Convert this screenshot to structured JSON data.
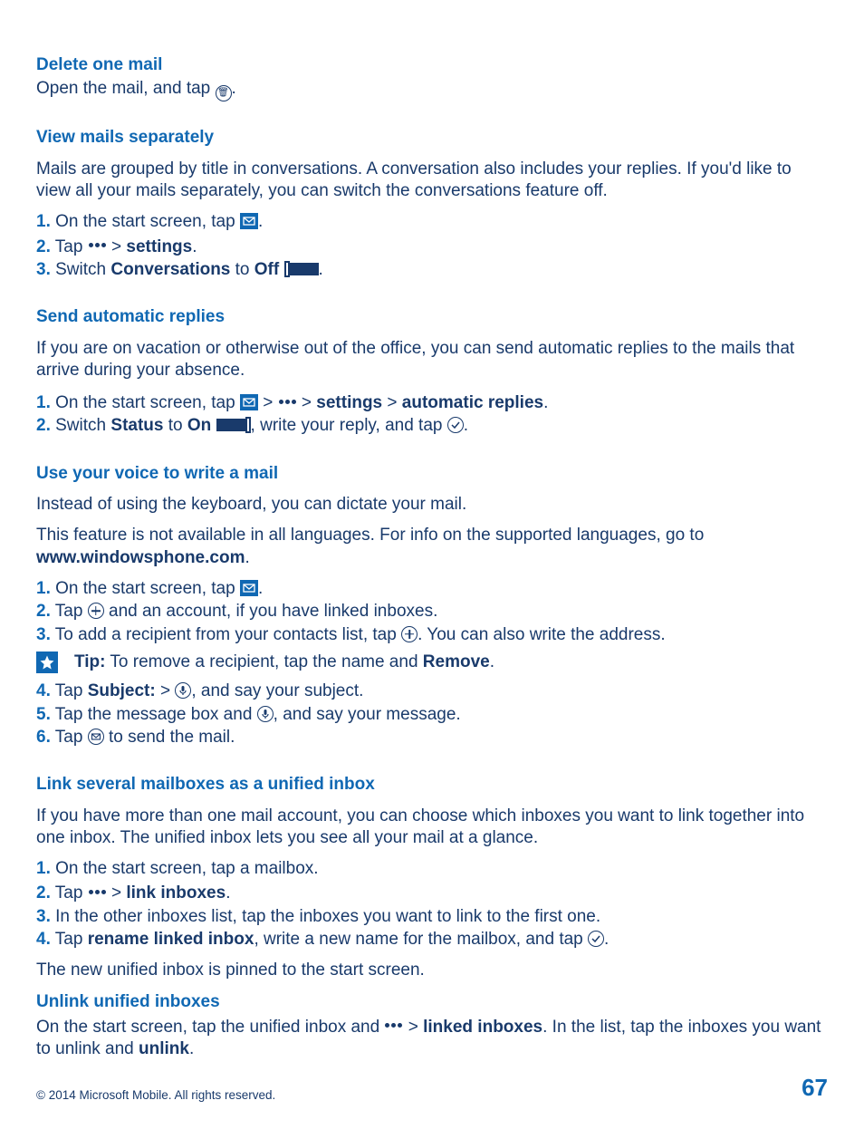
{
  "sec1": {
    "title": "Delete one mail",
    "line1a": "Open the mail, and tap ",
    "line1b": "."
  },
  "sec2": {
    "title": "View mails separately",
    "para": "Mails are grouped by title in conversations. A conversation also includes your replies. If you'd like to view all your mails separately, you can switch the conversations feature off.",
    "n1": "1.",
    "s1a": " On the start screen, tap ",
    "s1b": ".",
    "n2": "2.",
    "s2a": " Tap ",
    "s2b": " > ",
    "s2c": "settings",
    "s2d": ".",
    "n3": "3.",
    "s3a": " Switch ",
    "s3b": "Conversations",
    "s3c": " to ",
    "s3d": "Off",
    "s3e": " ",
    "s3f": "."
  },
  "sec3": {
    "title": "Send automatic replies",
    "para": "If you are on vacation or otherwise out of the office, you can send automatic replies to the mails that arrive during your absence.",
    "n1": "1.",
    "s1a": " On the start screen, tap ",
    "s1b": " > ",
    "s1c": " > ",
    "s1d": "settings",
    "s1e": " > ",
    "s1f": "automatic replies",
    "s1g": ".",
    "n2": "2.",
    "s2a": " Switch ",
    "s2b": "Status",
    "s2c": " to ",
    "s2d": "On",
    "s2e": " ",
    "s2f": ", write your reply, and tap ",
    "s2g": "."
  },
  "sec4": {
    "title": "Use your voice to write a mail",
    "para1": "Instead of using the keyboard, you can dictate your mail.",
    "para2a": "This feature is not available in all languages. For info on the supported languages, go to ",
    "para2b": "www.windowsphone.com",
    "para2c": ".",
    "n1": "1.",
    "s1a": " On the start screen, tap ",
    "s1b": ".",
    "n2": "2.",
    "s2a": " Tap ",
    "s2b": " and an account, if you have linked inboxes.",
    "n3": "3.",
    "s3a": " To add a recipient from your contacts list, tap ",
    "s3b": ". You can also write the address.",
    "tipLabel": "Tip:",
    "tipText": " To remove a recipient, tap the name and ",
    "tipBold": "Remove",
    "tipEnd": ".",
    "n4": "4.",
    "s4a": " Tap ",
    "s4b": "Subject:",
    "s4c": " > ",
    "s4d": ", and say your subject.",
    "n5": "5.",
    "s5a": " Tap the message box and ",
    "s5b": ", and say your message.",
    "n6": "6.",
    "s6a": " Tap ",
    "s6b": " to send the mail."
  },
  "sec5": {
    "title": "Link several mailboxes as a unified inbox",
    "para": "If you have more than one mail account, you can choose which inboxes you want to link together into one inbox. The unified inbox lets you see all your mail at a glance.",
    "n1": "1.",
    "s1": " On the start screen, tap a mailbox.",
    "n2": "2.",
    "s2a": " Tap ",
    "s2b": " > ",
    "s2c": "link inboxes",
    "s2d": ".",
    "n3": "3.",
    "s3": " In the other inboxes list, tap the inboxes you want to link to the first one.",
    "n4": "4.",
    "s4a": " Tap ",
    "s4b": "rename linked inbox",
    "s4c": ", write a new name for the mailbox, and tap ",
    "s4d": ".",
    "after": "The new unified inbox is pinned to the start screen."
  },
  "sec6": {
    "title": "Unlink unified inboxes",
    "l1a": "On the start screen, tap the unified inbox and ",
    "l1b": " > ",
    "l1c": "linked inboxes",
    "l1d": ". In the list, tap the inboxes you want to unlink and ",
    "l1e": "unlink",
    "l1f": "."
  },
  "footer": {
    "copyright": "© 2014 Microsoft Mobile. All rights reserved.",
    "page": "67"
  }
}
